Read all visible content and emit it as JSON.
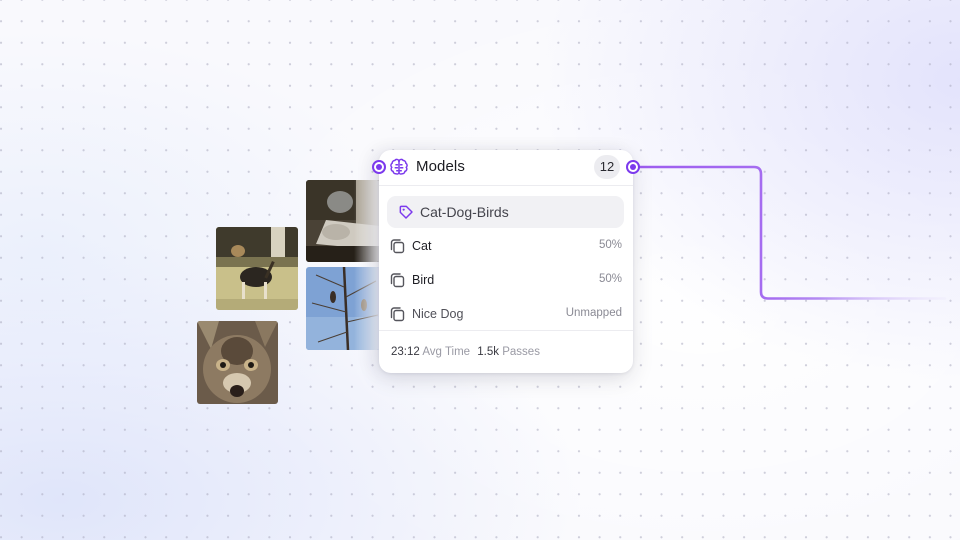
{
  "node": {
    "title": "Models",
    "icon": "brain-icon",
    "count": "12",
    "tag": {
      "icon": "tag-icon",
      "label": "Cat-Dog-Birds"
    },
    "classes": [
      {
        "icon": "copy-icon",
        "label": "Cat",
        "value": "50%"
      },
      {
        "icon": "copy-icon",
        "label": "Bird",
        "value": "50%"
      },
      {
        "icon": "copy-icon",
        "label": "Nice Dog",
        "value": "Unmapped"
      }
    ],
    "footer": {
      "avg_time_value": "23:12",
      "avg_time_label": "Avg Time",
      "passes_value": "1.5k",
      "passes_label": "Passes"
    }
  },
  "images": [
    {
      "subject": "dog-on-leash"
    },
    {
      "subject": "cat-face"
    },
    {
      "subject": "cat-and-bird"
    },
    {
      "subject": "birds-on-branch"
    }
  ],
  "colors": {
    "accent": "#7c3aed",
    "connector": "#a66ef0",
    "card_bg": "#ffffff",
    "tag_bg": "#f1f1f4",
    "badge_bg": "#ececf0"
  }
}
